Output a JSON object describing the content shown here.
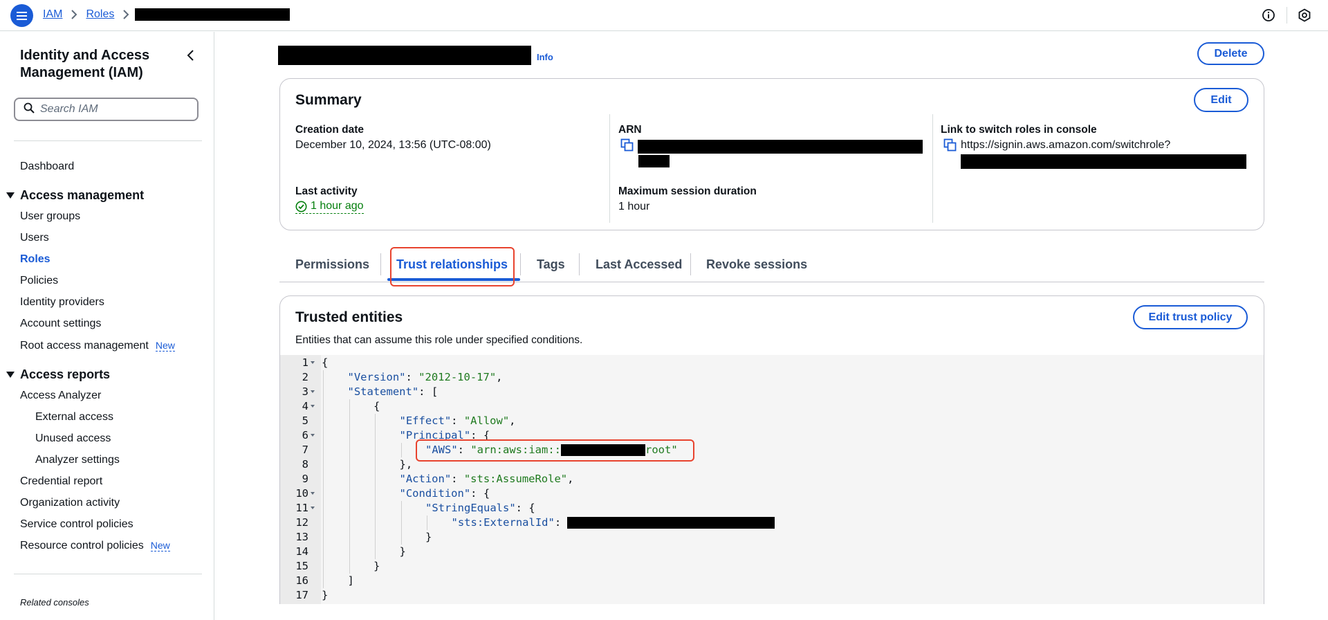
{
  "breadcrumb": {
    "items": [
      "IAM",
      "Roles"
    ]
  },
  "sidebar": {
    "title": "Identity and Access Management (IAM)",
    "search_placeholder": "Search IAM",
    "dashboard": "Dashboard",
    "access_management": {
      "label": "Access management",
      "items": [
        "User groups",
        "Users",
        "Roles",
        "Policies",
        "Identity providers",
        "Account settings",
        "Root access management"
      ]
    },
    "access_reports": {
      "label": "Access reports",
      "items": [
        "Access Analyzer",
        "External access",
        "Unused access",
        "Analyzer settings",
        "Credential report",
        "Organization activity",
        "Service control policies",
        "Resource control policies"
      ]
    },
    "new_badge": "New",
    "related_consoles": "Related consoles"
  },
  "header": {
    "info_link": "Info",
    "delete_label": "Delete"
  },
  "summary": {
    "title": "Summary",
    "edit_label": "Edit",
    "creation_date_label": "Creation date",
    "creation_date_value": "December 10, 2024, 13:56 (UTC-08:00)",
    "last_activity_label": "Last activity",
    "last_activity_value": "1 hour ago",
    "arn_label": "ARN",
    "max_session_label": "Maximum session duration",
    "max_session_value": "1 hour",
    "switch_link_label": "Link to switch roles in console",
    "switch_link_value": "https://signin.aws.amazon.com/switchrole?"
  },
  "tabs": [
    "Permissions",
    "Trust relationships",
    "Tags",
    "Last Accessed",
    "Revoke sessions"
  ],
  "active_tab": "Trust relationships",
  "trusted_entities": {
    "title": "Trusted entities",
    "description": "Entities that can assume this role under specified conditions.",
    "edit_label": "Edit trust policy"
  },
  "policy_lines": [
    {
      "n": "1",
      "fold": true,
      "indent": 0,
      "parts": [
        [
          "p",
          "{"
        ]
      ]
    },
    {
      "n": "2",
      "fold": false,
      "indent": 1,
      "parts": [
        [
          "k",
          "\"Version\""
        ],
        [
          "p",
          ": "
        ],
        [
          "s",
          "\"2012-10-17\""
        ],
        [
          "p",
          ","
        ]
      ]
    },
    {
      "n": "3",
      "fold": true,
      "indent": 1,
      "parts": [
        [
          "k",
          "\"Statement\""
        ],
        [
          "p",
          ": ["
        ]
      ]
    },
    {
      "n": "4",
      "fold": true,
      "indent": 2,
      "parts": [
        [
          "p",
          "{"
        ]
      ]
    },
    {
      "n": "5",
      "fold": false,
      "indent": 3,
      "parts": [
        [
          "k",
          "\"Effect\""
        ],
        [
          "p",
          ": "
        ],
        [
          "s",
          "\"Allow\""
        ],
        [
          "p",
          ","
        ]
      ]
    },
    {
      "n": "6",
      "fold": true,
      "indent": 3,
      "parts": [
        [
          "k",
          "\"Principal\""
        ],
        [
          "p",
          ": {"
        ]
      ]
    },
    {
      "n": "7",
      "fold": false,
      "indent": 4,
      "parts": [
        [
          "k",
          "\"AWS\""
        ],
        [
          "p",
          ": "
        ],
        [
          "s",
          "\"arn:aws:iam::"
        ],
        [
          "r",
          ""
        ],
        [
          "s",
          "root\""
        ]
      ]
    },
    {
      "n": "8",
      "fold": false,
      "indent": 3,
      "parts": [
        [
          "p",
          "},"
        ]
      ]
    },
    {
      "n": "9",
      "fold": false,
      "indent": 3,
      "parts": [
        [
          "k",
          "\"Action\""
        ],
        [
          "p",
          ": "
        ],
        [
          "s",
          "\"sts:AssumeRole\""
        ],
        [
          "p",
          ","
        ]
      ]
    },
    {
      "n": "10",
      "fold": true,
      "indent": 3,
      "parts": [
        [
          "k",
          "\"Condition\""
        ],
        [
          "p",
          ": {"
        ]
      ]
    },
    {
      "n": "11",
      "fold": true,
      "indent": 4,
      "parts": [
        [
          "k",
          "\"StringEquals\""
        ],
        [
          "p",
          ": {"
        ]
      ]
    },
    {
      "n": "12",
      "fold": false,
      "indent": 5,
      "parts": [
        [
          "k",
          "\"sts:ExternalId\""
        ],
        [
          "p",
          ": "
        ],
        [
          "r2",
          ""
        ]
      ]
    },
    {
      "n": "13",
      "fold": false,
      "indent": 4,
      "parts": [
        [
          "p",
          "}"
        ]
      ]
    },
    {
      "n": "14",
      "fold": false,
      "indent": 3,
      "parts": [
        [
          "p",
          "}"
        ]
      ]
    },
    {
      "n": "15",
      "fold": false,
      "indent": 2,
      "parts": [
        [
          "p",
          "}"
        ]
      ]
    },
    {
      "n": "16",
      "fold": false,
      "indent": 1,
      "parts": [
        [
          "p",
          "]"
        ]
      ]
    },
    {
      "n": "17",
      "fold": false,
      "indent": 0,
      "parts": [
        [
          "p",
          "}"
        ]
      ]
    }
  ],
  "colors": {
    "accent": "#1a5bd6",
    "success": "#037f0c",
    "highlight": "#e8432e"
  },
  "icons": [
    "menu-icon",
    "chevron-right-icon",
    "info-circle-icon",
    "settings-hexagon-icon",
    "chevron-left-icon",
    "search-icon",
    "check-circle-icon",
    "copy-icon"
  ]
}
